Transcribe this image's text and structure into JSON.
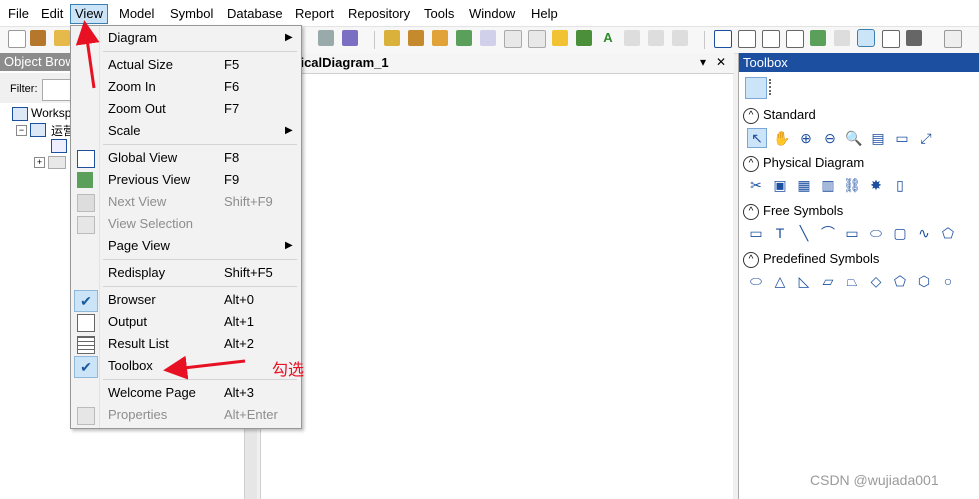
{
  "menubar": {
    "items": [
      "File",
      "Edit",
      "View",
      "Model",
      "Symbol",
      "Database",
      "Report",
      "Repository",
      "Tools",
      "Window",
      "Help"
    ]
  },
  "object_browser": {
    "title": "Object Brow",
    "filter_label": "Filter:",
    "tree": [
      "Worksp",
      "运营"
    ]
  },
  "diagram": {
    "tab_title": "ysicalDiagram_1",
    "pin_glyph": "▾",
    "close_glyph": "✕"
  },
  "toolbox": {
    "title": "Toolbox",
    "sections": [
      {
        "name": "Standard"
      },
      {
        "name": "Physical Diagram"
      },
      {
        "name": "Free Symbols"
      },
      {
        "name": "Predefined Symbols"
      }
    ]
  },
  "view_menu": {
    "items": [
      {
        "label": "Diagram",
        "key": "",
        "submenu": true
      },
      {
        "label": "Actual Size",
        "key": "F5"
      },
      {
        "label": "Zoom In",
        "key": "F6"
      },
      {
        "label": "Zoom Out",
        "key": "F7"
      },
      {
        "label": "Scale",
        "key": "",
        "submenu": true
      },
      {
        "label": "Global View",
        "key": "F8"
      },
      {
        "label": "Previous View",
        "key": "F9"
      },
      {
        "label": "Next View",
        "key": "Shift+F9"
      },
      {
        "label": "View Selection",
        "key": ""
      },
      {
        "label": "Page View",
        "key": "",
        "submenu": true
      },
      {
        "label": "Redisplay",
        "key": "Shift+F5"
      },
      {
        "label": "Browser",
        "key": "Alt+0",
        "checked": true
      },
      {
        "label": "Output",
        "key": "Alt+1"
      },
      {
        "label": "Result List",
        "key": "Alt+2"
      },
      {
        "label": "Toolbox",
        "key": "",
        "checked": true
      },
      {
        "label": "Welcome Page",
        "key": "Alt+3"
      },
      {
        "label": "Properties",
        "key": "Alt+Enter"
      }
    ]
  },
  "annotation": {
    "text": "勾选",
    "color": "#e81123"
  },
  "watermark": "CSDN @wujiada001"
}
